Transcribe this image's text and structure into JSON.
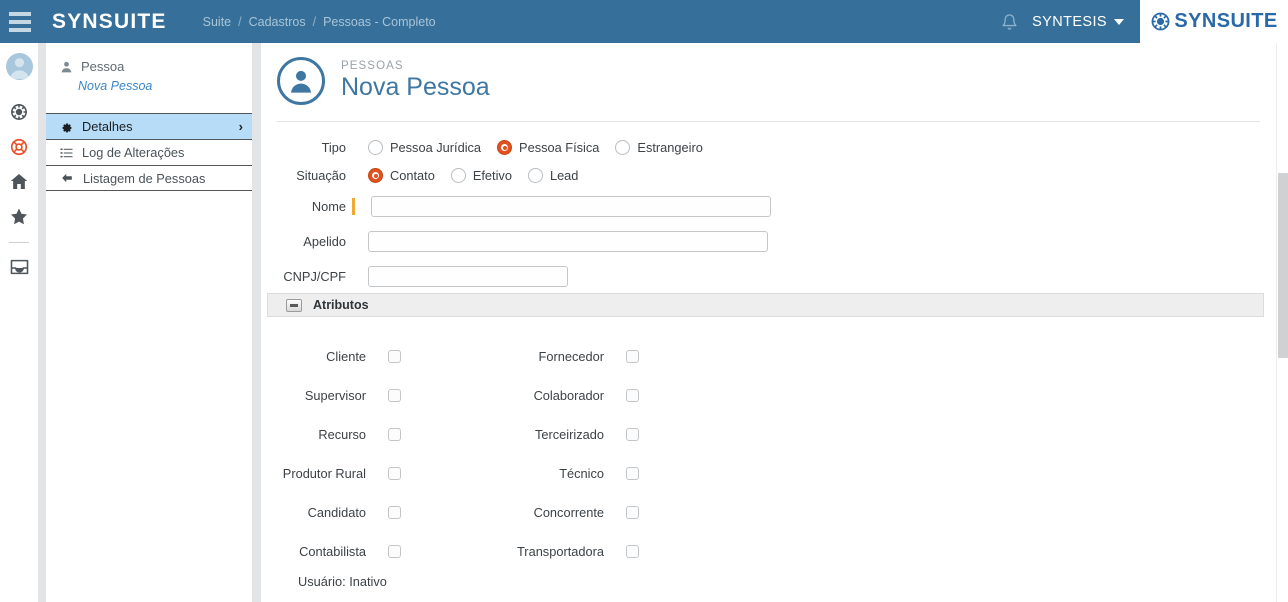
{
  "topbar": {
    "menu_icon": "hamburger-icon",
    "brand": "SYNSUITE",
    "breadcrumb": [
      "Suite",
      "Cadastros",
      "Pessoas - Completo"
    ],
    "separator": "/",
    "bell_icon": "bell-icon",
    "user_menu": "SYNTESIS",
    "logo_icon": "ship-wheel-icon",
    "logo_text": "SYNSUITE",
    "bg_color": "#36709a",
    "logo_color": "#2a69a8"
  },
  "rail": {
    "items": [
      {
        "icon": "user-avatar-icon",
        "name": "avatar"
      },
      {
        "icon": "ship-wheel-icon",
        "name": "rail-item-suite"
      },
      {
        "icon": "life-ring-icon",
        "name": "rail-item-support"
      },
      {
        "icon": "home-icon",
        "name": "rail-item-home"
      },
      {
        "icon": "star-icon",
        "name": "rail-item-favorites"
      },
      {
        "icon": "inbox-icon",
        "name": "rail-item-inbox"
      }
    ],
    "accent_color": "#e0521f"
  },
  "nav": {
    "header": "Pessoa",
    "header_icon": "person-icon",
    "subtitle": "Nova Pessoa",
    "items": [
      {
        "label": "Detalhes",
        "icon": "gear-icon",
        "active": true,
        "chevron": "›"
      },
      {
        "label": "Log de Alterações",
        "icon": "list-icon",
        "active": false
      },
      {
        "label": "Listagem de Pessoas",
        "icon": "arrow-left-icon",
        "active": false
      }
    ],
    "active_color": "#b7dcf7"
  },
  "page": {
    "icon": "person-circle-icon",
    "kicker": "PESSOAS",
    "title": "Nova Pessoa",
    "title_color": "#3f77a3"
  },
  "form": {
    "tipo": {
      "label": "Tipo",
      "options": [
        {
          "label": "Pessoa Jurídica",
          "selected": false
        },
        {
          "label": "Pessoa Física",
          "selected": true
        },
        {
          "label": "Estrangeiro",
          "selected": false
        }
      ]
    },
    "situacao": {
      "label": "Situação",
      "options": [
        {
          "label": "Contato",
          "selected": true
        },
        {
          "label": "Efetivo",
          "selected": false
        },
        {
          "label": "Lead",
          "selected": false
        }
      ]
    },
    "nome": {
      "label": "Nome",
      "value": "",
      "placeholder": "",
      "required": true
    },
    "apelido": {
      "label": "Apelido",
      "value": "",
      "placeholder": ""
    },
    "cnpj_cpf": {
      "label": "CNPJ/CPF",
      "value": "",
      "placeholder": ""
    },
    "required_marker_color": "#f0a830"
  },
  "section": {
    "title": "Atributos",
    "collapse_icon": "minus-icon"
  },
  "attributes": {
    "rows": [
      {
        "left": {
          "label": "Cliente",
          "checked": false
        },
        "right": {
          "label": "Fornecedor",
          "checked": false
        }
      },
      {
        "left": {
          "label": "Supervisor",
          "checked": false
        },
        "right": {
          "label": "Colaborador",
          "checked": false
        }
      },
      {
        "left": {
          "label": "Recurso",
          "checked": false
        },
        "right": {
          "label": "Terceirizado",
          "checked": false
        }
      },
      {
        "left": {
          "label": "Produtor Rural",
          "checked": false
        },
        "right": {
          "label": "Técnico",
          "checked": false
        }
      },
      {
        "left": {
          "label": "Candidato",
          "checked": false
        },
        "right": {
          "label": "Concorrente",
          "checked": false
        }
      },
      {
        "left": {
          "label": "Contabilista",
          "checked": false
        },
        "right": {
          "label": "Transportadora",
          "checked": false
        }
      }
    ],
    "usuario_status": "Usuário: Inativo"
  },
  "scrollbar": {
    "visible": true
  }
}
